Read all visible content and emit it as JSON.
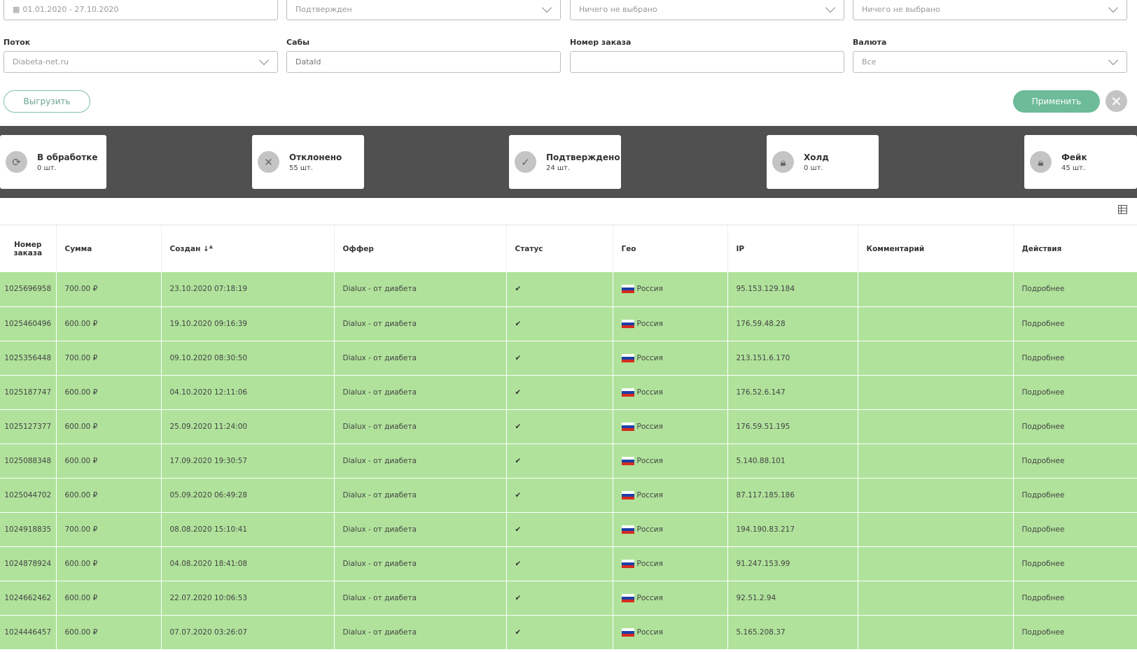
{
  "filters": {
    "date_range": "01.01.2020 - 27.10.2020",
    "status": "Подтвержден",
    "filter3": "Ничего не выбрано",
    "filter4": "Ничего не выбрано",
    "flow_label": "Поток",
    "flow_value": "Diabeta-net.ru",
    "subs_label": "Сабы",
    "subs_placeholder": "DataId",
    "order_label": "Номер заказа",
    "order_value": "",
    "currency_label": "Валюта",
    "currency_value": "Все",
    "export_label": "Выгрузить",
    "apply_label": "Применить"
  },
  "stats": [
    {
      "title": "В обработке",
      "count": "0 шт.",
      "icon": "refresh-icon"
    },
    {
      "title": "Отклонено",
      "count": "55 шт.",
      "icon": "x-icon"
    },
    {
      "title": "Подтверждено",
      "count": "24 шт.",
      "icon": "check-icon"
    },
    {
      "title": "Холд",
      "count": "0 шт.",
      "icon": "lock-icon"
    },
    {
      "title": "Фейк",
      "count": "45 шт.",
      "icon": "lock-icon"
    }
  ],
  "table": {
    "headers": [
      "Номер заказа",
      "Сумма",
      "Создан ↓ᴬ",
      "Оффер",
      "Статус",
      "Гео",
      "IP",
      "Комментарий",
      "Действия"
    ],
    "rows": [
      [
        "1025696958",
        "700.00 ₽",
        "23.10.2020 07:18:19",
        "Dialux - от диабета",
        "✔",
        "Россия",
        "95.153.129.184",
        "",
        "Подробнее"
      ],
      [
        "1025460496",
        "600.00 ₽",
        "19.10.2020 09:16:39",
        "Dialux - от диабета",
        "✔",
        "Россия",
        "176.59.48.28",
        "",
        "Подробнее"
      ],
      [
        "1025356448",
        "700.00 ₽",
        "09.10.2020 08:30:50",
        "Dialux - от диабета",
        "✔",
        "Россия",
        "213.151.6.170",
        "",
        "Подробнее"
      ],
      [
        "1025187747",
        "600.00 ₽",
        "04.10.2020 12:11:06",
        "Dialux - от диабета",
        "✔",
        "Россия",
        "176.52.6.147",
        "",
        "Подробнее"
      ],
      [
        "1025127377",
        "600.00 ₽",
        "25.09.2020 11:24:00",
        "Dialux - от диабета",
        "✔",
        "Россия",
        "176.59.51.195",
        "",
        "Подробнее"
      ],
      [
        "1025088348",
        "600.00 ₽",
        "17.09.2020 19:30:57",
        "Dialux - от диабета",
        "✔",
        "Россия",
        "5.140.88.101",
        "",
        "Подробнее"
      ],
      [
        "1025044702",
        "600.00 ₽",
        "05.09.2020 06:49:28",
        "Dialux - от диабета",
        "✔",
        "Россия",
        "87.117.185.186",
        "",
        "Подробнее"
      ],
      [
        "1024918835",
        "700.00 ₽",
        "08.08.2020 15:10:41",
        "Dialux - от диабета",
        "✔",
        "Россия",
        "194.190.83.217",
        "",
        "Подробнее"
      ],
      [
        "1024878924",
        "600.00 ₽",
        "04.08.2020 18:41:08",
        "Dialux - от диабета",
        "✔",
        "Россия",
        "91.247.153.99",
        "",
        "Подробнее"
      ],
      [
        "1024662462",
        "600.00 ₽",
        "22.07.2020 10:06:53",
        "Dialux - от диабета",
        "✔",
        "Россия",
        "92.51.2.94",
        "",
        "Подробнее"
      ],
      [
        "1024446457",
        "600.00 ₽",
        "07.07.2020 03:26:07",
        "Dialux - от диабета",
        "✔",
        "Россия",
        "5.165.208.37",
        "",
        "Подробнее"
      ]
    ]
  }
}
